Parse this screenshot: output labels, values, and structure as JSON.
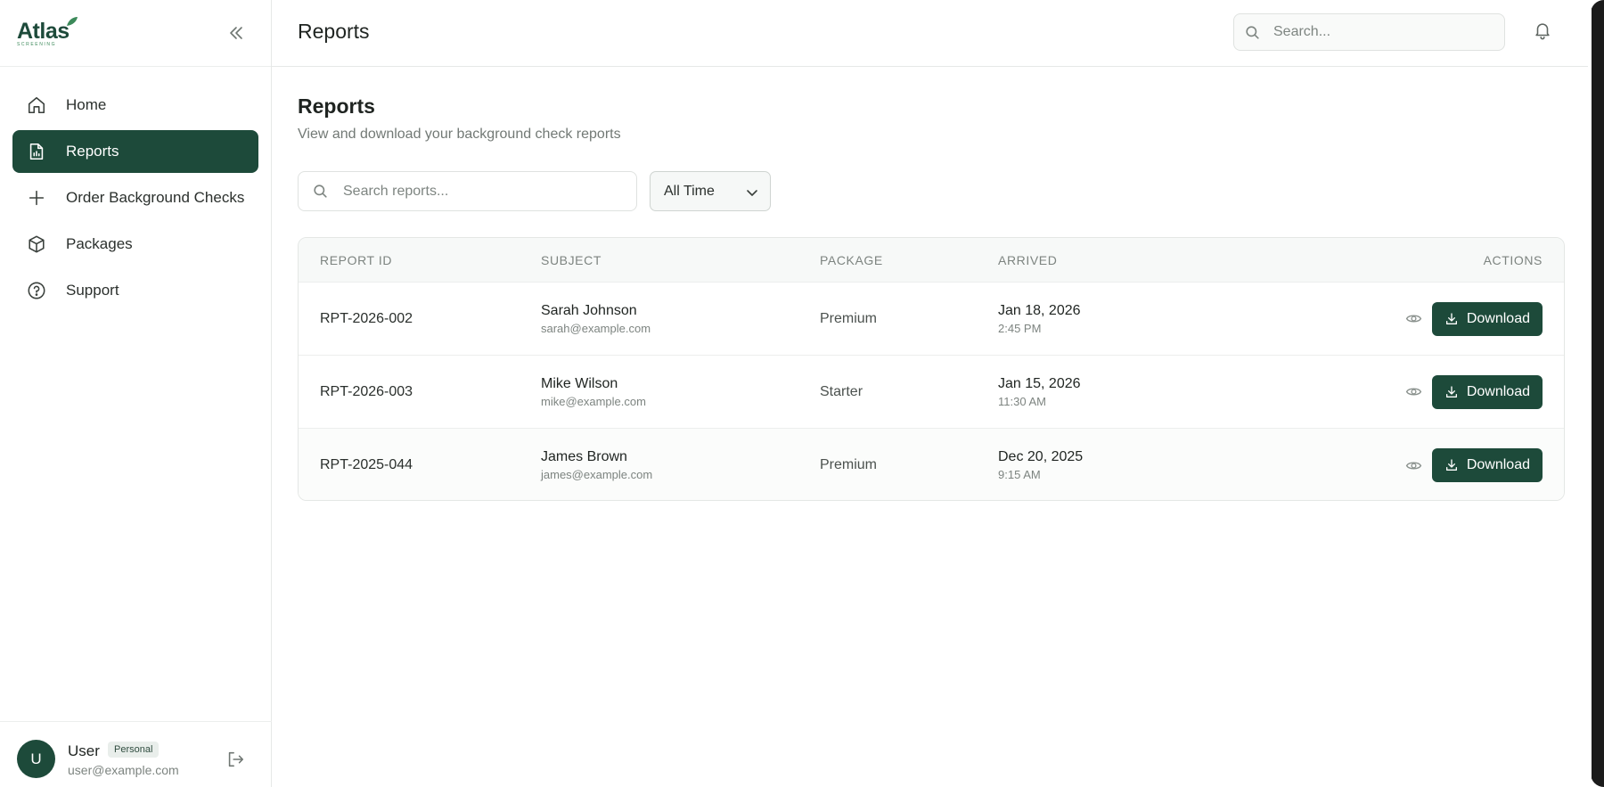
{
  "brand": {
    "name": "Atlas",
    "tagline": "SCREENING"
  },
  "sidebar": {
    "items": [
      {
        "label": "Home",
        "icon": "home-icon"
      },
      {
        "label": "Reports",
        "icon": "report-icon",
        "active": true
      },
      {
        "label": "Order Background Checks",
        "icon": "plus-icon"
      },
      {
        "label": "Packages",
        "icon": "package-icon"
      },
      {
        "label": "Support",
        "icon": "help-icon"
      }
    ],
    "user": {
      "initial": "U",
      "name": "User",
      "badge": "Personal",
      "email": "user@example.com"
    }
  },
  "header": {
    "title": "Reports",
    "search_placeholder": "Search..."
  },
  "main": {
    "title": "Reports",
    "subtitle": "View and download your background check reports",
    "search_placeholder": "Search reports...",
    "filter": {
      "selected": "All Time"
    },
    "table": {
      "columns": [
        "REPORT ID",
        "SUBJECT",
        "PACKAGE",
        "ARRIVED",
        "ACTIONS"
      ],
      "download_label": "Download",
      "rows": [
        {
          "id": "RPT-2026-002",
          "name": "Sarah Johnson",
          "email": "sarah@example.com",
          "package": "Premium",
          "date": "Jan 18, 2026",
          "time": "2:45 PM"
        },
        {
          "id": "RPT-2026-003",
          "name": "Mike Wilson",
          "email": "mike@example.com",
          "package": "Starter",
          "date": "Jan 15, 2026",
          "time": "11:30 AM"
        },
        {
          "id": "RPT-2025-044",
          "name": "James Brown",
          "email": "james@example.com",
          "package": "Premium",
          "date": "Dec 20, 2025",
          "time": "9:15 AM"
        }
      ]
    }
  },
  "colors": {
    "accent": "#1d4a3a",
    "border": "#e6e8e7",
    "muted_text": "#7d8480"
  }
}
